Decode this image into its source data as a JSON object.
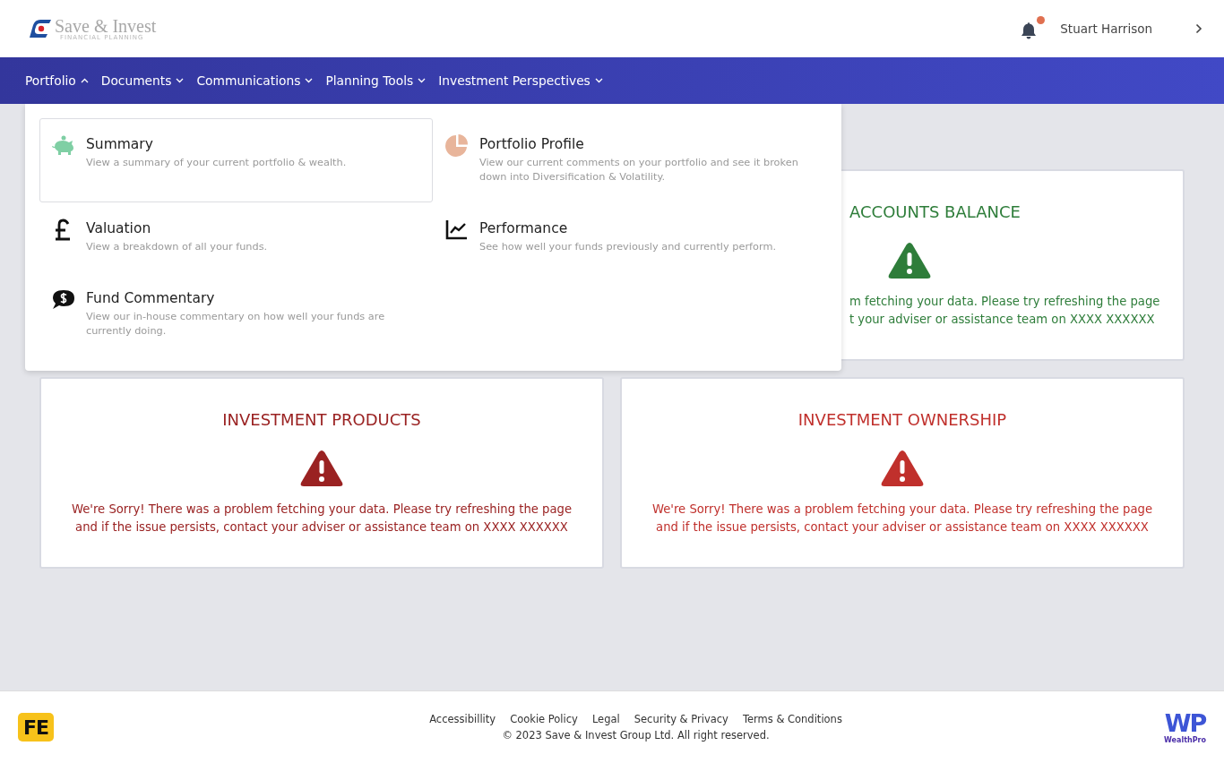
{
  "header": {
    "logo": {
      "name": "Save & Invest",
      "tagline": "FINANCIAL PLANNING"
    },
    "notifications": {
      "unread": true
    },
    "user": {
      "name": "Stuart Harrison"
    }
  },
  "nav": [
    {
      "label": "Portfolio",
      "expanded": true
    },
    {
      "label": "Documents",
      "expanded": false
    },
    {
      "label": "Communications",
      "expanded": false
    },
    {
      "label": "Planning Tools",
      "expanded": false
    },
    {
      "label": "Investment Perspectives",
      "expanded": false
    }
  ],
  "portfolio_menu": [
    {
      "title": "Summary",
      "description": "View a summary of your current portfolio & wealth.",
      "selected": true
    },
    {
      "title": "Portfolio Profile",
      "description": "View our current comments on your portfolio and see it broken down into Diversification & Volatility.",
      "selected": false
    },
    {
      "title": "Valuation",
      "description": "View a breakdown of all your funds.",
      "selected": false
    },
    {
      "title": "Performance",
      "description": "See how well your funds previously and currently perform.",
      "selected": false
    },
    {
      "title": "Fund Commentary",
      "description": "View our in-house commentary on how well your funds are currently doing.",
      "selected": false
    }
  ],
  "cards": [
    {
      "title": "ACCOUNTS BALANCE",
      "message": [
        "m fetching your data. Please try refreshing the page",
        "t your adviser or assistance team on XXXX XXXXXX"
      ],
      "color": "#2e7d3a",
      "partly_hidden": true
    },
    {
      "title": "INVESTMENT PRODUCTS",
      "message": [
        "We're Sorry! There was a problem fetching your data. Please try refreshing the page",
        "and if the issue persists, contact your adviser or assistance team on XXXX XXXXXX"
      ],
      "color": "#9a2222",
      "partly_hidden": false
    },
    {
      "title": "INVESTMENT OWNERSHIP",
      "message": [
        "We're Sorry! There was a problem fetching your data. Please try refreshing the page",
        "and if the issue persists, contact your adviser or assistance team on XXXX XXXXXX"
      ],
      "color": "#c0302c",
      "partly_hidden": false
    }
  ],
  "footer": {
    "left_logo": "FE",
    "links": [
      "Accessibillity",
      "Cookie Policy",
      "Legal",
      "Security & Privacy",
      "Terms & Conditions"
    ],
    "copyright": "© 2023 Save & Invest Group Ltd. All right reserved.",
    "right_logo": {
      "mark": "WP",
      "name": "WealthPro"
    }
  }
}
